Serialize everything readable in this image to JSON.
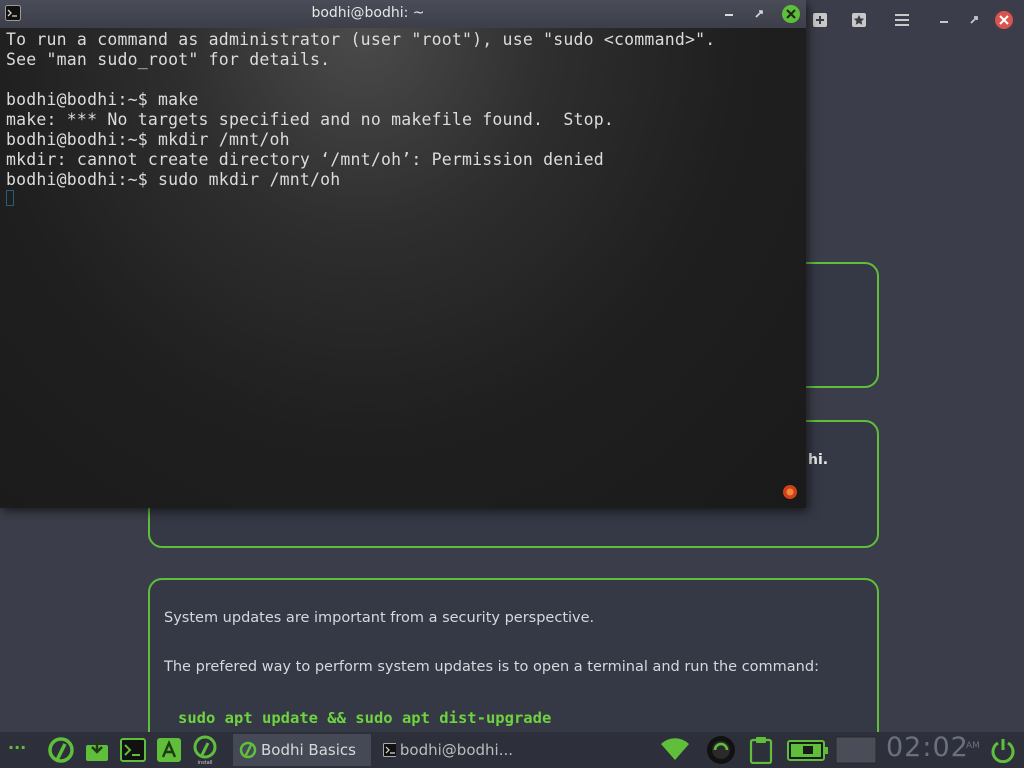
{
  "terminal": {
    "title": "bodhi@bodhi: ~",
    "lines": [
      "To run a command as administrator (user \"root\"), use \"sudo <command>\".",
      "See \"man sudo_root\" for details.",
      "",
      "bodhi@bodhi:~$ make",
      "make: *** No targets specified and no makefile found.  Stop.",
      "bodhi@bodhi:~$ mkdir /mnt/oh",
      "mkdir: cannot create directory ‘/mnt/oh’: Permission denied",
      "bodhi@bodhi:~$ sudo mkdir /mnt/oh"
    ]
  },
  "background_page": {
    "card2_fragment": "hi.",
    "card3": {
      "text1": "System updates are important from a security perspective.",
      "text2": "The prefered way to perform system updates is to open a terminal and run the command:",
      "code": "sudo apt update && sudo apt dist-upgrade"
    }
  },
  "taskbar": {
    "menu_dots": "···",
    "tasks": [
      {
        "label": "Bodhi Basics"
      },
      {
        "label": "bodhi@bodhi..."
      }
    ],
    "install_label": "install",
    "clock": "02:02",
    "ampm": "AM"
  },
  "colors": {
    "accent": "#5fbf3a",
    "background": "#3b3e4a",
    "terminal_bg": "#1c1c1c"
  }
}
